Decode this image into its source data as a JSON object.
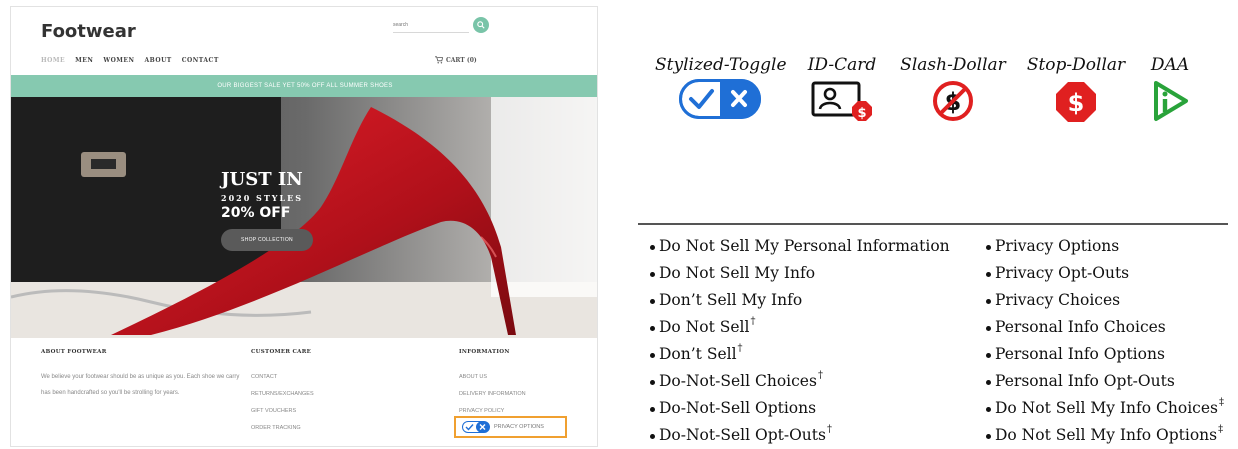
{
  "store": {
    "logo": "Footwear",
    "search_placeholder": "search",
    "nav": [
      "HOME",
      "MEN",
      "WOMEN",
      "ABOUT",
      "CONTACT"
    ],
    "cart": "CART (0)",
    "promo": "OUR BIGGEST SALE YET 50% OFF ALL SUMMER SHOES",
    "hero": {
      "title": "JUST IN",
      "subtitle": "2020 STYLES",
      "offer": "20% OFF",
      "button": "SHOP COLLECTION"
    },
    "footer": {
      "about_heading": "ABOUT FOOTWEAR",
      "about_text": "We believe your footwear should be as unique as you. Each shoe we carry has been handcrafted so you'll be strolling for years.",
      "service_heading": "CUSTOMER CARE",
      "service_links": [
        "CONTACT",
        "RETURNS/EXCHANGES",
        "GIFT VOUCHERS",
        "ORDER TRACKING"
      ],
      "info_heading": "INFORMATION",
      "info_links": [
        "ABOUT US",
        "DELIVERY INFORMATION",
        "PRIVACY POLICY"
      ],
      "privacy_options": "PRIVACY OPTIONS"
    }
  },
  "icons": [
    {
      "label": "Stylized-Toggle",
      "icon": "toggle-check-x-icon"
    },
    {
      "label": "ID-Card",
      "icon": "id-card-dollar-icon"
    },
    {
      "label": "Slash-Dollar",
      "icon": "slash-dollar-icon"
    },
    {
      "label": "Stop-Dollar",
      "icon": "stop-dollar-icon"
    },
    {
      "label": "DAA",
      "icon": "daa-icon"
    }
  ],
  "colors": {
    "toggle_blue": "#1f6fd6",
    "stop_red": "#e02020",
    "daa_green": "#29a33a",
    "promo_teal": "#86c9b0",
    "highlight_orange": "#f0a030"
  },
  "list_left": [
    {
      "text": "Do Not Sell My Personal Information",
      "sup": ""
    },
    {
      "text": "Do Not Sell My Info",
      "sup": ""
    },
    {
      "text": "Don’t Sell My Info",
      "sup": ""
    },
    {
      "text": "Do Not Sell",
      "sup": "†"
    },
    {
      "text": "Don’t Sell",
      "sup": "†"
    },
    {
      "text": "Do-Not-Sell Choices",
      "sup": "†"
    },
    {
      "text": "Do-Not-Sell Options",
      "sup": ""
    },
    {
      "text": "Do-Not-Sell Opt-Outs",
      "sup": "†"
    }
  ],
  "list_right": [
    {
      "text": "Privacy Options",
      "sup": ""
    },
    {
      "text": "Privacy Opt-Outs",
      "sup": ""
    },
    {
      "text": "Privacy Choices",
      "sup": ""
    },
    {
      "text": "Personal Info Choices",
      "sup": ""
    },
    {
      "text": "Personal Info Options",
      "sup": ""
    },
    {
      "text": "Personal Info Opt-Outs",
      "sup": ""
    },
    {
      "text": "Do Not Sell My Info Choices",
      "sup": "‡"
    },
    {
      "text": "Do Not Sell My Info Options",
      "sup": "‡"
    }
  ]
}
